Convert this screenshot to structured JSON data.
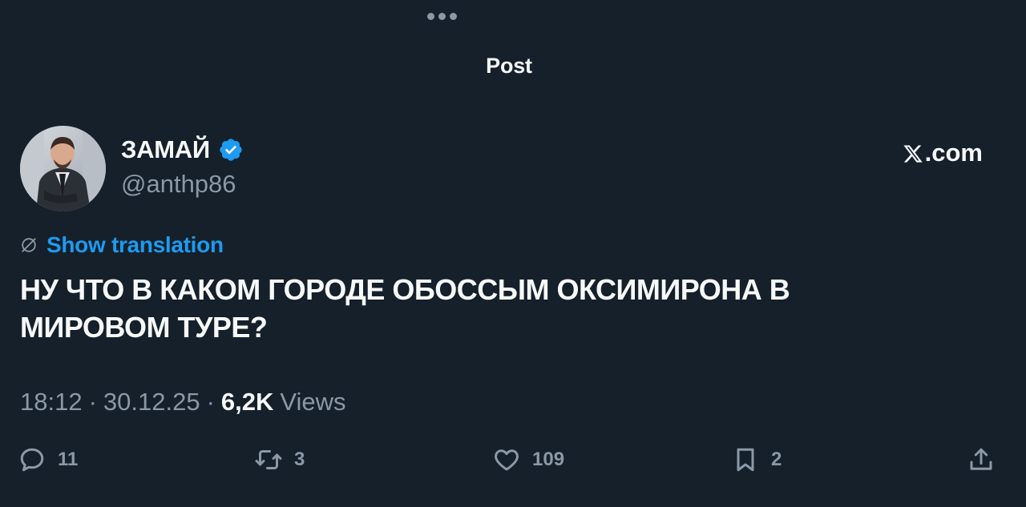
{
  "header": {
    "title": "Post",
    "more_icon": "more-horizontal-icon"
  },
  "author": {
    "display_name": "ЗАМАЙ",
    "handle": "@anthp86",
    "verified": true,
    "verified_color": "#1d9bf0"
  },
  "brand": {
    "logo_icon": "x-logo-icon",
    "suffix": ".com"
  },
  "translation": {
    "link_label": "Show translation",
    "icon": "globe-icon",
    "color": "#1d9bf0"
  },
  "post": {
    "text": "НУ ЧТО В КАКОМ ГОРОДЕ ОБОССЫМ ОКСИМИРОНА В МИРОВОМ ТУРЕ?"
  },
  "meta": {
    "time": "18:12",
    "separator": "·",
    "date": "30.12.25",
    "views_count": "6,2K",
    "views_label": "Views"
  },
  "actions": {
    "reply": {
      "icon": "reply-icon",
      "count": "11"
    },
    "repost": {
      "icon": "repost-icon",
      "count": "3"
    },
    "like": {
      "icon": "heart-icon",
      "count": "109"
    },
    "bookmark": {
      "icon": "bookmark-icon",
      "count": "2"
    },
    "share": {
      "icon": "share-icon"
    }
  },
  "colors": {
    "background": "#15202b",
    "text_primary": "#f7f9f9",
    "text_secondary": "#8b98a5",
    "accent": "#1d9bf0"
  }
}
